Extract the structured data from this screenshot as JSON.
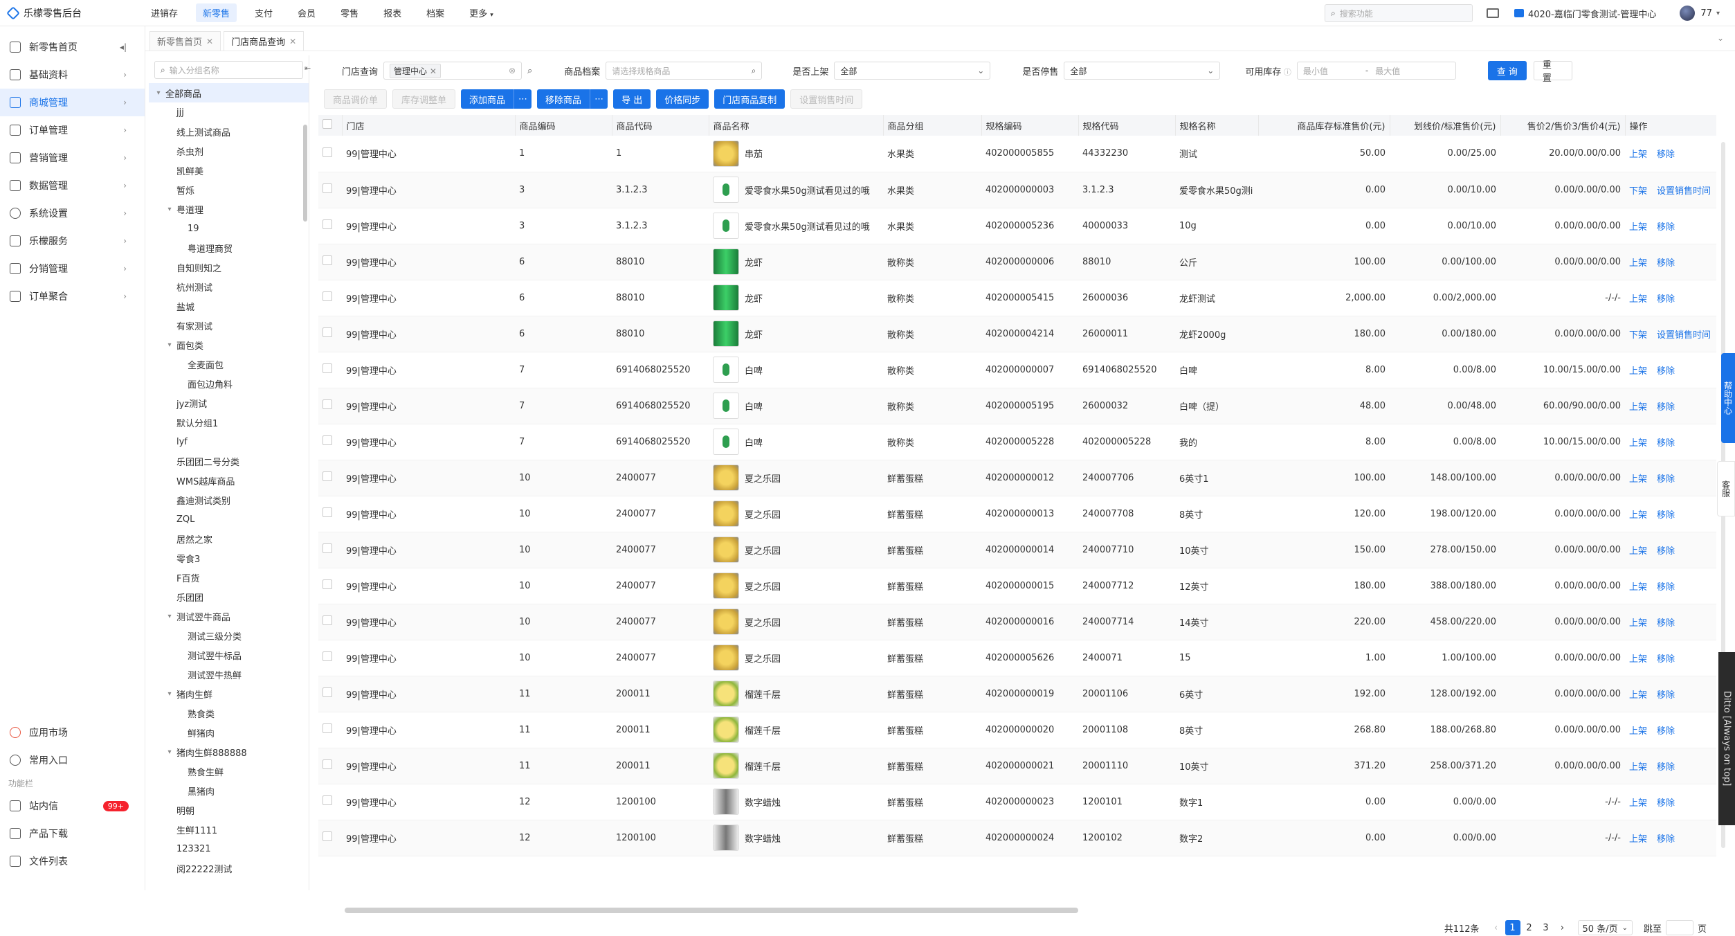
{
  "topbar": {
    "app_name": "乐檬零售后台",
    "nav": [
      "进销存",
      "新零售",
      "支付",
      "会员",
      "零售",
      "报表",
      "档案",
      "更多"
    ],
    "active_nav": "新零售",
    "search_placeholder": "搜索功能",
    "store": "4020-嘉临门零食测试-管理中心",
    "user": "77"
  },
  "sidebar": {
    "items": [
      {
        "label": "新零售首页",
        "icon": "home-icon"
      },
      {
        "label": "基础资料",
        "icon": "grid-icon"
      },
      {
        "label": "商城管理",
        "icon": "shop-icon",
        "active": true
      },
      {
        "label": "订单管理",
        "icon": "order-icon"
      },
      {
        "label": "营销管理",
        "icon": "marketing-icon"
      },
      {
        "label": "数据管理",
        "icon": "chart-icon"
      },
      {
        "label": "系统设置",
        "icon": "settings-icon"
      },
      {
        "label": "乐檬服务",
        "icon": "service-icon"
      },
      {
        "label": "分销管理",
        "icon": "distribution-icon"
      },
      {
        "label": "订单聚合",
        "icon": "aggregate-icon"
      }
    ],
    "bottom": [
      {
        "label": "应用市场",
        "icon": "app-market-icon"
      },
      {
        "label": "常用入口",
        "icon": "heart-icon"
      }
    ],
    "section_label": "功能栏",
    "tools": [
      {
        "label": "站内信",
        "icon": "mail-icon",
        "badge": "99+"
      },
      {
        "label": "产品下载",
        "icon": "download-icon"
      },
      {
        "label": "文件列表",
        "icon": "file-icon"
      }
    ]
  },
  "tabs": [
    {
      "label": "新零售首页",
      "active": false
    },
    {
      "label": "门店商品查询",
      "active": true
    }
  ],
  "tree": {
    "search_placeholder": "输入分组名称",
    "nodes": [
      {
        "label": "全部商品",
        "level": 0,
        "arrow": "▾",
        "root": true
      },
      {
        "label": "jjj",
        "level": 1
      },
      {
        "label": "线上测试商品",
        "level": 1
      },
      {
        "label": "杀虫剂",
        "level": 1
      },
      {
        "label": "凯鲜美",
        "level": 1
      },
      {
        "label": "暂烁",
        "level": 1
      },
      {
        "label": "粤道理",
        "level": 1,
        "arrow": "▾"
      },
      {
        "label": "19",
        "level": 2
      },
      {
        "label": "粤道理商贸",
        "level": 2
      },
      {
        "label": "自知则知之",
        "level": 1
      },
      {
        "label": "杭州测试",
        "level": 1
      },
      {
        "label": "盐城",
        "level": 1
      },
      {
        "label": "有家测试",
        "level": 1
      },
      {
        "label": "面包类",
        "level": 1,
        "arrow": "▾"
      },
      {
        "label": "全麦面包",
        "level": 2
      },
      {
        "label": "面包边角料",
        "level": 2
      },
      {
        "label": "jyz测试",
        "level": 1
      },
      {
        "label": "默认分组1",
        "level": 1
      },
      {
        "label": "lyf",
        "level": 1
      },
      {
        "label": "乐团团二号分类",
        "level": 1
      },
      {
        "label": "WMS越库商品",
        "level": 1
      },
      {
        "label": "鑫迪测试类别",
        "level": 1
      },
      {
        "label": "ZQL",
        "level": 1
      },
      {
        "label": "居然之家",
        "level": 1
      },
      {
        "label": "零食3",
        "level": 1
      },
      {
        "label": "F百货",
        "level": 1
      },
      {
        "label": "乐团团",
        "level": 1
      },
      {
        "label": "测试翌牛商品",
        "level": 1,
        "arrow": "▾"
      },
      {
        "label": "测试三级分类",
        "level": 2
      },
      {
        "label": "测试翌牛标品",
        "level": 2
      },
      {
        "label": "测试翌牛热鲜",
        "level": 2
      },
      {
        "label": "猪肉生鲜",
        "level": 1,
        "arrow": "▾"
      },
      {
        "label": "熟食类",
        "level": 2
      },
      {
        "label": "鲜猪肉",
        "level": 2
      },
      {
        "label": "猪肉生鲜888888",
        "level": 1,
        "arrow": "▾"
      },
      {
        "label": "熟食生鲜",
        "level": 2
      },
      {
        "label": "黑猪肉",
        "level": 2
      },
      {
        "label": "明朝",
        "level": 1
      },
      {
        "label": "生鲜1111",
        "level": 1
      },
      {
        "label": "123321",
        "level": 1
      },
      {
        "label": "阅22222测试",
        "level": 1
      }
    ]
  },
  "filters": {
    "store_label": "门店查询",
    "store_value": "管理中心",
    "archive_label": "商品档案",
    "archive_placeholder": "请选择规格商品",
    "listed_label": "是否上架",
    "listed_value": "全部",
    "stopped_label": "是否停售",
    "stopped_value": "全部",
    "stock_label": "可用库存",
    "min_placeholder": "最小值",
    "range_sep": "-",
    "max_placeholder": "最大值",
    "query": "查 询",
    "reset": "重 置"
  },
  "actions": {
    "price_adjust": "商品调价单",
    "stock_adjust": "库存调整单",
    "add": "添加商品",
    "remove": "移除商品",
    "export": "导 出",
    "price_sync": "价格同步",
    "copy": "门店商品复制",
    "set_time": "设置销售时间",
    "more": "⋯"
  },
  "table": {
    "columns": [
      "门店",
      "商品编码",
      "商品代码",
      "商品名称",
      "商品分组",
      "规格编码",
      "规格代码",
      "规格名称",
      "商品库存标准售价(元)",
      "划线价/标准售价(元)",
      "售价2/售价3/售价4(元)",
      "操作"
    ],
    "rows": [
      {
        "store": "99|管理中心",
        "code": "1",
        "pcode": "1",
        "name": "串茄",
        "thumb": "yellow",
        "group": "水果类",
        "skuno": "402000005855",
        "skucode": "44332230",
        "sku": "测试",
        "price": "50.00",
        "line": "0.00/25.00",
        "p234": "20.00/0.00/0.00",
        "ops": [
          "上架",
          "移除"
        ]
      },
      {
        "store": "99|管理中心",
        "code": "3",
        "pcode": "3.1.2.3",
        "name": "爱零食水果50g测试看见过的哦",
        "thumb": "green",
        "group": "水果类",
        "skuno": "402000000003",
        "skucode": "3.1.2.3",
        "sku": "爱零食水果50g测i",
        "price": "0.00",
        "line": "0.00/10.00",
        "p234": "0.00/0.00/0.00",
        "ops": [
          "下架",
          "设置销售时间"
        ]
      },
      {
        "store": "99|管理中心",
        "code": "3",
        "pcode": "3.1.2.3",
        "name": "爱零食水果50g测试看见过的哦",
        "thumb": "green",
        "group": "水果类",
        "skuno": "402000005236",
        "skucode": "40000033",
        "sku": "10g",
        "price": "0.00",
        "line": "0.00/10.00",
        "p234": "0.00/0.00/0.00",
        "ops": [
          "上架",
          "移除"
        ]
      },
      {
        "store": "99|管理中心",
        "code": "6",
        "pcode": "88010",
        "name": "龙虾",
        "thumb": "can",
        "group": "散称类",
        "skuno": "402000000006",
        "skucode": "88010",
        "sku": "公斤",
        "price": "100.00",
        "line": "0.00/100.00",
        "p234": "0.00/0.00/0.00",
        "ops": [
          "上架",
          "移除"
        ]
      },
      {
        "store": "99|管理中心",
        "code": "6",
        "pcode": "88010",
        "name": "龙虾",
        "thumb": "can",
        "group": "散称类",
        "skuno": "402000005415",
        "skucode": "26000036",
        "sku": "龙虾测试",
        "price": "2,000.00",
        "line": "0.00/2,000.00",
        "p234": "-/-/-",
        "ops": [
          "上架",
          "移除"
        ]
      },
      {
        "store": "99|管理中心",
        "code": "6",
        "pcode": "88010",
        "name": "龙虾",
        "thumb": "can",
        "group": "散称类",
        "skuno": "402000004214",
        "skucode": "26000011",
        "sku": "龙虾2000g",
        "price": "180.00",
        "line": "0.00/180.00",
        "p234": "0.00/0.00/0.00",
        "ops": [
          "下架",
          "设置销售时间"
        ]
      },
      {
        "store": "99|管理中心",
        "code": "7",
        "pcode": "6914068025520",
        "name": "白啤",
        "thumb": "green",
        "group": "散称类",
        "skuno": "402000000007",
        "skucode": "6914068025520",
        "sku": "白啤",
        "price": "8.00",
        "line": "0.00/8.00",
        "p234": "10.00/15.00/0.00",
        "ops": [
          "上架",
          "移除"
        ]
      },
      {
        "store": "99|管理中心",
        "code": "7",
        "pcode": "6914068025520",
        "name": "白啤",
        "thumb": "green",
        "group": "散称类",
        "skuno": "402000005195",
        "skucode": "26000032",
        "sku": "白啤（提）",
        "price": "48.00",
        "line": "0.00/48.00",
        "p234": "60.00/90.00/0.00",
        "ops": [
          "上架",
          "移除"
        ]
      },
      {
        "store": "99|管理中心",
        "code": "7",
        "pcode": "6914068025520",
        "name": "白啤",
        "thumb": "green",
        "group": "散称类",
        "skuno": "402000005228",
        "skucode": "402000005228",
        "sku": "我的",
        "price": "8.00",
        "line": "0.00/8.00",
        "p234": "10.00/15.00/0.00",
        "ops": [
          "上架",
          "移除"
        ]
      },
      {
        "store": "99|管理中心",
        "code": "10",
        "pcode": "2400077",
        "name": "夏之乐园",
        "thumb": "yellow",
        "group": "鲜蓄蛋糕",
        "skuno": "402000000012",
        "skucode": "240007706",
        "sku": "6英寸1",
        "price": "100.00",
        "line": "148.00/100.00",
        "p234": "0.00/0.00/0.00",
        "ops": [
          "上架",
          "移除"
        ]
      },
      {
        "store": "99|管理中心",
        "code": "10",
        "pcode": "2400077",
        "name": "夏之乐园",
        "thumb": "yellow",
        "group": "鲜蓄蛋糕",
        "skuno": "402000000013",
        "skucode": "240007708",
        "sku": "8英寸",
        "price": "120.00",
        "line": "198.00/120.00",
        "p234": "0.00/0.00/0.00",
        "ops": [
          "上架",
          "移除"
        ]
      },
      {
        "store": "99|管理中心",
        "code": "10",
        "pcode": "2400077",
        "name": "夏之乐园",
        "thumb": "yellow",
        "group": "鲜蓄蛋糕",
        "skuno": "402000000014",
        "skucode": "240007710",
        "sku": "10英寸",
        "price": "150.00",
        "line": "278.00/150.00",
        "p234": "0.00/0.00/0.00",
        "ops": [
          "上架",
          "移除"
        ]
      },
      {
        "store": "99|管理中心",
        "code": "10",
        "pcode": "2400077",
        "name": "夏之乐园",
        "thumb": "yellow",
        "group": "鲜蓄蛋糕",
        "skuno": "402000000015",
        "skucode": "240007712",
        "sku": "12英寸",
        "price": "180.00",
        "line": "388.00/180.00",
        "p234": "0.00/0.00/0.00",
        "ops": [
          "上架",
          "移除"
        ]
      },
      {
        "store": "99|管理中心",
        "code": "10",
        "pcode": "2400077",
        "name": "夏之乐园",
        "thumb": "yellow",
        "group": "鲜蓄蛋糕",
        "skuno": "402000000016",
        "skucode": "240007714",
        "sku": "14英寸",
        "price": "220.00",
        "line": "458.00/220.00",
        "p234": "0.00/0.00/0.00",
        "ops": [
          "上架",
          "移除"
        ]
      },
      {
        "store": "99|管理中心",
        "code": "10",
        "pcode": "2400077",
        "name": "夏之乐园",
        "thumb": "yellow",
        "group": "鲜蓄蛋糕",
        "skuno": "402000005626",
        "skucode": "2400071",
        "sku": "15",
        "price": "1.00",
        "line": "1.00/100.00",
        "p234": "0.00/0.00/0.00",
        "ops": [
          "上架",
          "移除"
        ]
      },
      {
        "store": "99|管理中心",
        "code": "11",
        "pcode": "200011",
        "name": "榴莲千层",
        "thumb": "cake",
        "group": "鲜蓄蛋糕",
        "skuno": "402000000019",
        "skucode": "20001106",
        "sku": "6英寸",
        "price": "192.00",
        "line": "128.00/192.00",
        "p234": "0.00/0.00/0.00",
        "ops": [
          "上架",
          "移除"
        ]
      },
      {
        "store": "99|管理中心",
        "code": "11",
        "pcode": "200011",
        "name": "榴莲千层",
        "thumb": "cake",
        "group": "鲜蓄蛋糕",
        "skuno": "402000000020",
        "skucode": "20001108",
        "sku": "8英寸",
        "price": "268.80",
        "line": "188.00/268.80",
        "p234": "0.00/0.00/0.00",
        "ops": [
          "上架",
          "移除"
        ]
      },
      {
        "store": "99|管理中心",
        "code": "11",
        "pcode": "200011",
        "name": "榴莲千层",
        "thumb": "cake",
        "group": "鲜蓄蛋糕",
        "skuno": "402000000021",
        "skucode": "20001110",
        "sku": "10英寸",
        "price": "371.20",
        "line": "258.00/371.20",
        "p234": "0.00/0.00/0.00",
        "ops": [
          "上架",
          "移除"
        ]
      },
      {
        "store": "99|管理中心",
        "code": "12",
        "pcode": "1200100",
        "name": "数字蜡烛",
        "thumb": "candle",
        "group": "鲜蓄蛋糕",
        "skuno": "402000000023",
        "skucode": "1200101",
        "sku": "数字1",
        "price": "0.00",
        "line": "0.00/0.00",
        "p234": "-/-/-",
        "ops": [
          "上架",
          "移除"
        ]
      },
      {
        "store": "99|管理中心",
        "code": "12",
        "pcode": "1200100",
        "name": "数字蜡烛",
        "thumb": "candle",
        "group": "鲜蓄蛋糕",
        "skuno": "402000000024",
        "skucode": "1200102",
        "sku": "数字2",
        "price": "0.00",
        "line": "0.00/0.00",
        "p234": "-/-/-",
        "ops": [
          "上架",
          "移除"
        ]
      }
    ]
  },
  "pager": {
    "total": "共112条",
    "pages": [
      "1",
      "2",
      "3"
    ],
    "current": "1",
    "next": "›",
    "prev": "‹",
    "size": "50 条/页",
    "jump_label": "跳至",
    "page_suffix": "页"
  },
  "float": {
    "help": "帮助中心",
    "service": "客服",
    "ditto": "Ditto [Always on top]"
  },
  "colors": {
    "accent": "#1a73e8"
  }
}
